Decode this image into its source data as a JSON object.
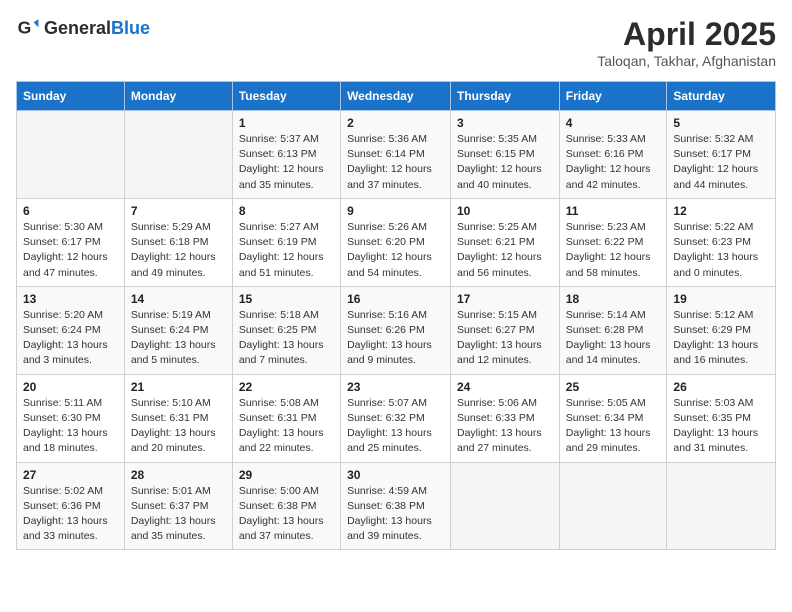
{
  "header": {
    "logo_general": "General",
    "logo_blue": "Blue",
    "month_title": "April 2025",
    "location": "Taloqan, Takhar, Afghanistan"
  },
  "weekdays": [
    "Sunday",
    "Monday",
    "Tuesday",
    "Wednesday",
    "Thursday",
    "Friday",
    "Saturday"
  ],
  "weeks": [
    [
      {
        "day": "",
        "info": ""
      },
      {
        "day": "",
        "info": ""
      },
      {
        "day": "1",
        "info": "Sunrise: 5:37 AM\nSunset: 6:13 PM\nDaylight: 12 hours and 35 minutes."
      },
      {
        "day": "2",
        "info": "Sunrise: 5:36 AM\nSunset: 6:14 PM\nDaylight: 12 hours and 37 minutes."
      },
      {
        "day": "3",
        "info": "Sunrise: 5:35 AM\nSunset: 6:15 PM\nDaylight: 12 hours and 40 minutes."
      },
      {
        "day": "4",
        "info": "Sunrise: 5:33 AM\nSunset: 6:16 PM\nDaylight: 12 hours and 42 minutes."
      },
      {
        "day": "5",
        "info": "Sunrise: 5:32 AM\nSunset: 6:17 PM\nDaylight: 12 hours and 44 minutes."
      }
    ],
    [
      {
        "day": "6",
        "info": "Sunrise: 5:30 AM\nSunset: 6:17 PM\nDaylight: 12 hours and 47 minutes."
      },
      {
        "day": "7",
        "info": "Sunrise: 5:29 AM\nSunset: 6:18 PM\nDaylight: 12 hours and 49 minutes."
      },
      {
        "day": "8",
        "info": "Sunrise: 5:27 AM\nSunset: 6:19 PM\nDaylight: 12 hours and 51 minutes."
      },
      {
        "day": "9",
        "info": "Sunrise: 5:26 AM\nSunset: 6:20 PM\nDaylight: 12 hours and 54 minutes."
      },
      {
        "day": "10",
        "info": "Sunrise: 5:25 AM\nSunset: 6:21 PM\nDaylight: 12 hours and 56 minutes."
      },
      {
        "day": "11",
        "info": "Sunrise: 5:23 AM\nSunset: 6:22 PM\nDaylight: 12 hours and 58 minutes."
      },
      {
        "day": "12",
        "info": "Sunrise: 5:22 AM\nSunset: 6:23 PM\nDaylight: 13 hours and 0 minutes."
      }
    ],
    [
      {
        "day": "13",
        "info": "Sunrise: 5:20 AM\nSunset: 6:24 PM\nDaylight: 13 hours and 3 minutes."
      },
      {
        "day": "14",
        "info": "Sunrise: 5:19 AM\nSunset: 6:24 PM\nDaylight: 13 hours and 5 minutes."
      },
      {
        "day": "15",
        "info": "Sunrise: 5:18 AM\nSunset: 6:25 PM\nDaylight: 13 hours and 7 minutes."
      },
      {
        "day": "16",
        "info": "Sunrise: 5:16 AM\nSunset: 6:26 PM\nDaylight: 13 hours and 9 minutes."
      },
      {
        "day": "17",
        "info": "Sunrise: 5:15 AM\nSunset: 6:27 PM\nDaylight: 13 hours and 12 minutes."
      },
      {
        "day": "18",
        "info": "Sunrise: 5:14 AM\nSunset: 6:28 PM\nDaylight: 13 hours and 14 minutes."
      },
      {
        "day": "19",
        "info": "Sunrise: 5:12 AM\nSunset: 6:29 PM\nDaylight: 13 hours and 16 minutes."
      }
    ],
    [
      {
        "day": "20",
        "info": "Sunrise: 5:11 AM\nSunset: 6:30 PM\nDaylight: 13 hours and 18 minutes."
      },
      {
        "day": "21",
        "info": "Sunrise: 5:10 AM\nSunset: 6:31 PM\nDaylight: 13 hours and 20 minutes."
      },
      {
        "day": "22",
        "info": "Sunrise: 5:08 AM\nSunset: 6:31 PM\nDaylight: 13 hours and 22 minutes."
      },
      {
        "day": "23",
        "info": "Sunrise: 5:07 AM\nSunset: 6:32 PM\nDaylight: 13 hours and 25 minutes."
      },
      {
        "day": "24",
        "info": "Sunrise: 5:06 AM\nSunset: 6:33 PM\nDaylight: 13 hours and 27 minutes."
      },
      {
        "day": "25",
        "info": "Sunrise: 5:05 AM\nSunset: 6:34 PM\nDaylight: 13 hours and 29 minutes."
      },
      {
        "day": "26",
        "info": "Sunrise: 5:03 AM\nSunset: 6:35 PM\nDaylight: 13 hours and 31 minutes."
      }
    ],
    [
      {
        "day": "27",
        "info": "Sunrise: 5:02 AM\nSunset: 6:36 PM\nDaylight: 13 hours and 33 minutes."
      },
      {
        "day": "28",
        "info": "Sunrise: 5:01 AM\nSunset: 6:37 PM\nDaylight: 13 hours and 35 minutes."
      },
      {
        "day": "29",
        "info": "Sunrise: 5:00 AM\nSunset: 6:38 PM\nDaylight: 13 hours and 37 minutes."
      },
      {
        "day": "30",
        "info": "Sunrise: 4:59 AM\nSunset: 6:38 PM\nDaylight: 13 hours and 39 minutes."
      },
      {
        "day": "",
        "info": ""
      },
      {
        "day": "",
        "info": ""
      },
      {
        "day": "",
        "info": ""
      }
    ]
  ]
}
